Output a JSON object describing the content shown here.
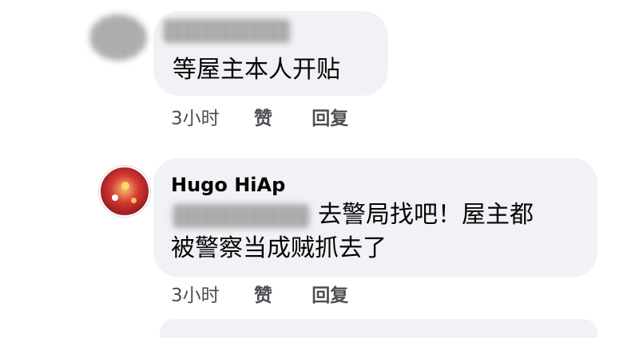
{
  "comments": [
    {
      "author_redacted": true,
      "text": "等屋主本人开贴",
      "time": "3小时",
      "like_label": "赞",
      "reply_label": "回复"
    },
    {
      "author": "Hugo HiAp",
      "text_line1": "去警局找吧！屋主都",
      "text_line2": "被警察当成贼抓去了",
      "time": "3小时",
      "like_label": "赞",
      "reply_label": "回复"
    }
  ],
  "colors": {
    "bubble": "#f0f2f5",
    "meta_text": "#4c4e52",
    "text": "#050505"
  }
}
